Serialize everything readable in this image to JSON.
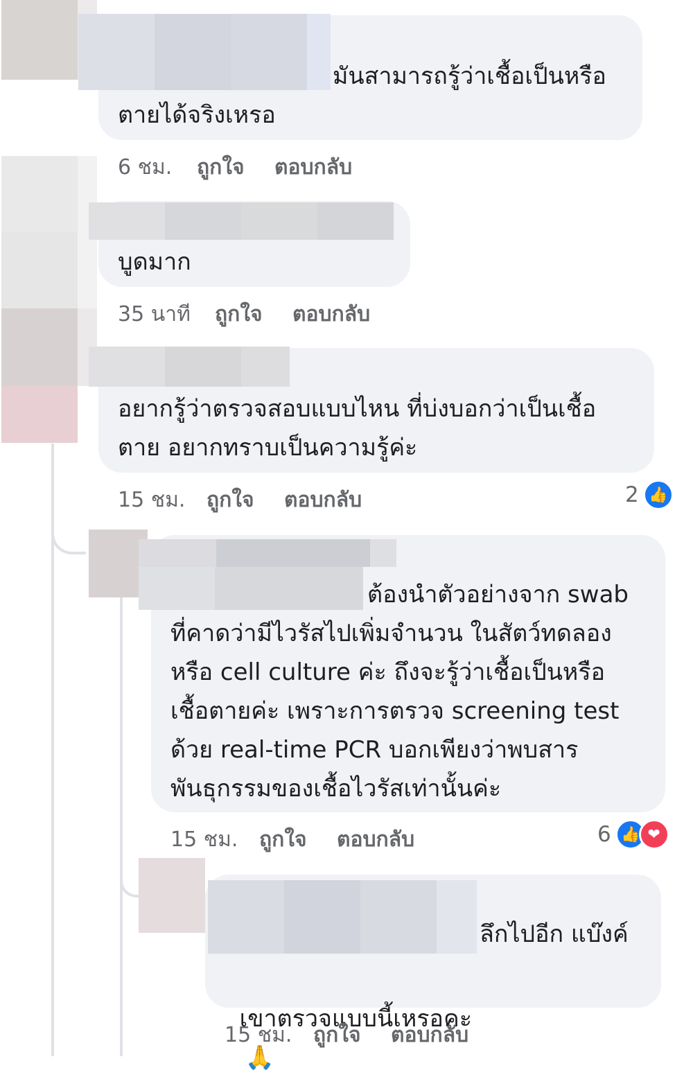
{
  "comments": [
    {
      "text_line1": "มันสามารถรู้ว่าเชื้อเป็นหรือ",
      "text_line2": "ตายได้จริงเหรอ",
      "time": "6 ชม.",
      "like_label": "ถูกใจ",
      "reply_label": "ตอบกลับ"
    },
    {
      "text_line1": "บูดมาก",
      "time": "35 นาที",
      "like_label": "ถูกใจ",
      "reply_label": "ตอบกลับ"
    },
    {
      "text_line1": "อยากรู้ว่าตรวจสอบแบบไหน ที่บ่งบอกว่าเป็นเชื้อ",
      "text_line2": "ตาย อยากทราบเป็นความรู้ค่ะ",
      "time": "15 ชม.",
      "like_label": "ถูกใจ",
      "reply_label": "ตอบกลับ",
      "reaction_count": "2"
    }
  ],
  "replies": [
    {
      "text_line1": "ต้องนำตัวอย่างจาก swab",
      "text_line2": "ที่คาดว่ามีไวรัสไปเพิ่มจำนวน ในสัตว์ทดลอง",
      "text_line3": "หรือ cell culture ค่ะ ถึงจะรู้ว่าเชื้อเป็นหรือ",
      "text_line4": "เชื้อตายค่ะ เพราะการตรวจ screening test",
      "text_line5": "ด้วย real-time PCR บอกเพียงว่าพบสาร",
      "text_line6": "พันธุกรรมของเชื้อไวรัสเท่านั้นค่ะ",
      "time": "15 ชม.",
      "like_label": "ถูกใจ",
      "reply_label": "ตอบกลับ",
      "reaction_count": "6"
    },
    {
      "text_line1": "ลึกไปอีก แบ๊งค์",
      "text_line2": "เขาตรวจแบบนี้เหรอคะ",
      "emoji": "🙏",
      "time": "15 ชม.",
      "like_label": "ถูกใจ",
      "reply_label": "ตอบกลับ"
    }
  ],
  "icons": {
    "like_icon": "👍",
    "love_icon": "❤"
  },
  "colors": {
    "bubble": "#f0f2f5",
    "like_blue": "#1877f2",
    "love_red": "#f33e58",
    "meta_text": "#65676b"
  }
}
